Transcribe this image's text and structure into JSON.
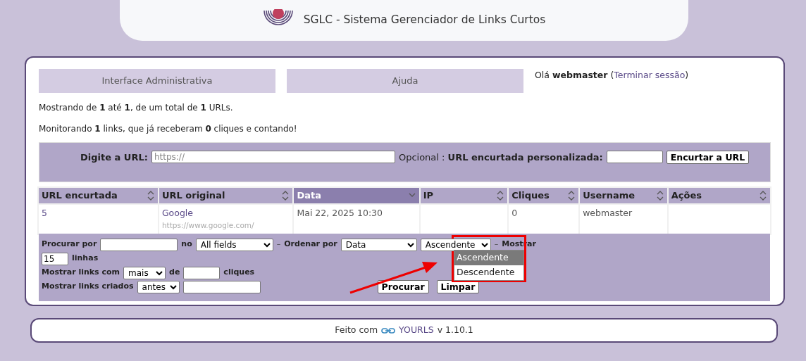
{
  "header": {
    "title": "SGLC - Sistema Gerenciador de Links Curtos"
  },
  "tabs": [
    {
      "label": "Interface Administrativa",
      "selected": false
    },
    {
      "label": "Ajuda",
      "selected": false
    }
  ],
  "greeting": {
    "text": "Olá **webmaster** (",
    "logout": "Terminar sessão",
    "close": ")"
  },
  "status_lines": [
    "Mostrando de **1** até **1**, de um total de **1** URLs.",
    "Monitorando **1** links, que já receberam **0** cliques e contando!"
  ],
  "new_url": {
    "label": "Digite a URL:",
    "placeholder": "https://",
    "custom_label": "Opcional : **URL encurtada personalizada:**",
    "button": "Encurtar a URL"
  },
  "table": {
    "columns": [
      {
        "label": "URL encurtada",
        "sorted": false
      },
      {
        "label": "URL original",
        "sorted": false
      },
      {
        "label": "Data",
        "sorted": true
      },
      {
        "label": "IP",
        "sorted": false
      },
      {
        "label": "Cliques",
        "sorted": false
      },
      {
        "label": "Username",
        "sorted": false
      },
      {
        "label": "Ações",
        "sorted": false
      }
    ],
    "rows": [
      {
        "short": "5",
        "title": "Google",
        "url": "https://www.google.com/",
        "date": "Mai 22, 2025 10:30",
        "clicks": "0",
        "username": "webmaster"
      }
    ]
  },
  "filters": {
    "search_label": "Procurar por",
    "in_label": "no",
    "field": "All fields",
    "order_label": "Ordenar por",
    "order": "Data",
    "direction": "Ascendente",
    "show_label": "Mostrar",
    "rows_value": "15",
    "rows_label": "linhas",
    "clicks_label": "Mostrar links com",
    "clicks_compare": "mais",
    "of_label": "de",
    "clicks_unit": "cliques",
    "created_label": "Mostrar links criados",
    "created_compare": "antes",
    "buttons": [
      "Procurar",
      "Limpar"
    ],
    "dash": "–"
  },
  "direction_menu": {
    "options": [
      {
        "label": "Ascendente",
        "selected": true
      },
      {
        "label": "Descendente",
        "selected": false
      }
    ]
  },
  "footer": {
    "prefix": "Feito com",
    "link": "YOURLS",
    "version": "v 1.10.1"
  }
}
